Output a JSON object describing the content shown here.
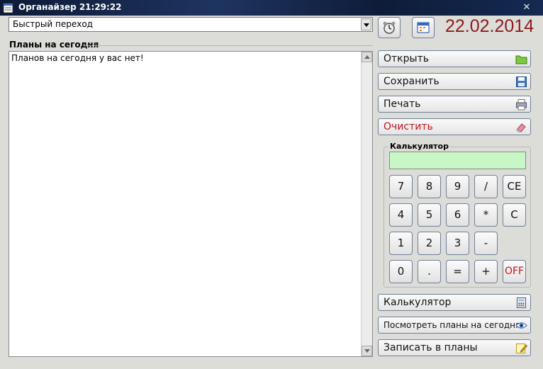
{
  "window": {
    "title": "Органайзер  21:29:22",
    "close_glyph": "✕"
  },
  "quick_nav": {
    "value": "Быстрый переход"
  },
  "toolbar": {
    "alarm_icon": "alarm-clock-icon",
    "calendar_icon": "calendar-icon",
    "date": "22.02.2014"
  },
  "plans": {
    "label": "Планы на сегодня",
    "text": "Планов на сегодня у вас нет!"
  },
  "buttons": {
    "open": "Открыть",
    "save": "Сохранить",
    "print": "Печать",
    "clear": "Очистить",
    "calculator": "Калькулятор",
    "view_plans": "Посмотреть планы на сегодня",
    "write_plans": "Записать в планы"
  },
  "calculator": {
    "label": "Калькулятор",
    "display": "",
    "keys": {
      "k7": "7",
      "k8": "8",
      "k9": "9",
      "div": "/",
      "ce": "CE",
      "k4": "4",
      "k5": "5",
      "k6": "6",
      "mul": "*",
      "c": "C",
      "k1": "1",
      "k2": "2",
      "k3": "3",
      "sub": "-",
      "k0": "0",
      "dot": ".",
      "eq": "=",
      "add": "+",
      "off": "OFF"
    }
  },
  "colors": {
    "date": "#8b1c1c",
    "danger": "#c0161c",
    "display": "#c8f7c5",
    "window": "#dcdcd9"
  }
}
